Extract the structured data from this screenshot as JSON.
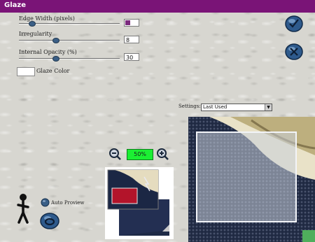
{
  "window": {
    "title": "Glaze"
  },
  "controls": {
    "edge_width": {
      "label": "Edge Width (pixels)",
      "value": ""
    },
    "irregularity": {
      "label": "Irregularity",
      "value": "8"
    },
    "opacity": {
      "label": "Internal Opacity (%)",
      "value": "30"
    },
    "glaze_color": {
      "label": "Glaze Color"
    }
  },
  "settings": {
    "label": "Settings:",
    "selected": "Last Used"
  },
  "zoom": {
    "value": "50%"
  },
  "preview": {
    "auto_preview_label": "Auto Proview"
  },
  "icons": {
    "ok": "checkmark-icon",
    "cancel": "x-icon",
    "zoom_out": "magnify-minus-icon",
    "zoom_in": "magnify-plus-icon",
    "help": "stickman-icon",
    "eye": "eye-icon",
    "proof": "proof-toggle-icon"
  },
  "colors": {
    "titlebar": "#7a1477",
    "zoom_box": "#1bef33",
    "edge_swatch": "#7b2a7d"
  }
}
